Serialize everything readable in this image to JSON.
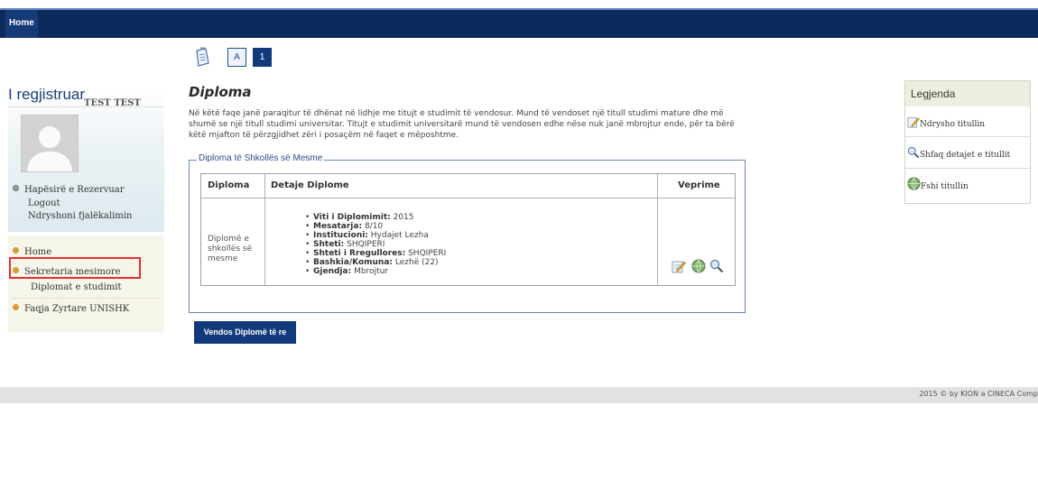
{
  "nav": {
    "home_tab": "Home"
  },
  "sidebar": {
    "title": "I regjistruar",
    "user_name": "TEST TEST",
    "reserved_area": "Hapësirë e Rezervuar",
    "logout": "Logout",
    "change_password": "Ndryshoni fjalëkalimin",
    "menu": [
      {
        "label": "Home"
      },
      {
        "label": "Sekretaria mesimore"
      },
      {
        "label": "Diplomat e studimit"
      },
      {
        "label": "Faqja Zyrtare UNISHK"
      }
    ],
    "bullet_color": "#c98a2e"
  },
  "pager": {
    "page_a": "A",
    "page_1": "1"
  },
  "main": {
    "title": "Diploma",
    "intro": "Në këtë faqe janë paraqitur të dhënat në lidhje me titujt e studimit të vendosur. Mund të vendoset një titull studimi mature dhe më shumë se një titull studimi universitar. Titujt e studimit universitarë mund të vendosen edhe nëse nuk janë mbrojtur ende, për ta bërë këtë mjafton të përzgjidhet zëri i posaçëm në faqet e mëposhtme.",
    "fieldset_title": "Diploma të Shkollës së Mesme",
    "table": {
      "headers": [
        "Diploma",
        "Detaje Diplome",
        "Veprime"
      ],
      "row": {
        "diploma": "Diplomë e shkollës së mesme",
        "details": [
          {
            "label": "Viti i Diplomimit:",
            "value": "2015"
          },
          {
            "label": "Mesatarja:",
            "value": "8/10"
          },
          {
            "label": "Institucioni:",
            "value": "Hydajet Lezha"
          },
          {
            "label": "Shteti:",
            "value": "SHQIPERI"
          },
          {
            "label": "Shteti i Rregullores:",
            "value": "SHQIPERI"
          },
          {
            "label": "Bashkia/Komuna:",
            "value": "Lezhë (22)"
          },
          {
            "label": "Gjendja:",
            "value": "Mbrojtur"
          }
        ]
      }
    },
    "add_button": "Vendos Diplomë të re"
  },
  "legend": {
    "title": "Legjenda",
    "items": [
      {
        "label": "Ndrysho titullin",
        "icon": "edit-icon"
      },
      {
        "label": "Shfaq detajet e titullit",
        "icon": "magnifier-icon"
      },
      {
        "label": "Fshi titullin",
        "icon": "globe-delete-icon"
      }
    ]
  },
  "footer": {
    "text": "2015 © by KION a CINECA Comp"
  },
  "colors": {
    "nav": "#0d2a5c",
    "highlight": "#e53030",
    "legend_head": "#eaf0dd"
  }
}
